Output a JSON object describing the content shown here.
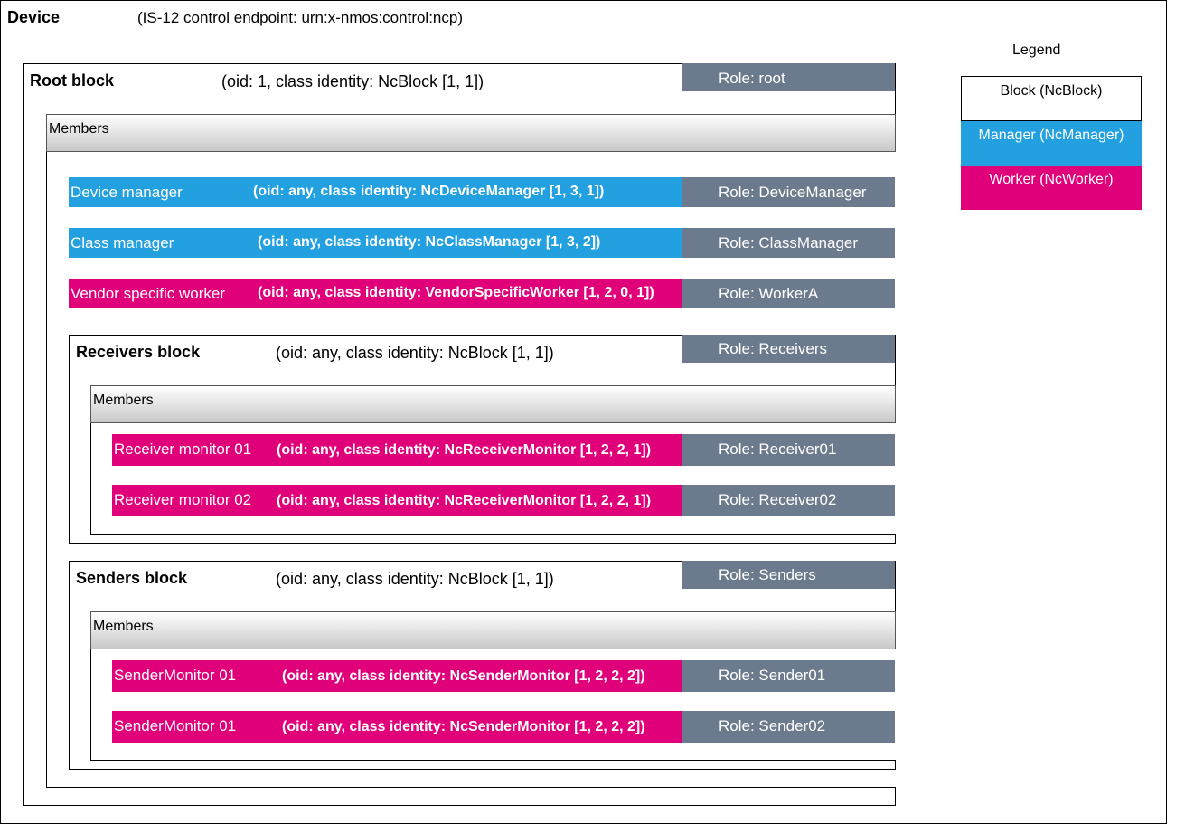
{
  "device": {
    "title": "Device",
    "subtitle": "(IS-12 control endpoint: urn:x-nmos:control:ncp)"
  },
  "legend": {
    "title": "Legend",
    "block": "Block (NcBlock)",
    "manager": "Manager (NcManager)",
    "worker": "Worker (NcWorker)"
  },
  "root": {
    "title": "Root block",
    "identity": "(oid: 1, class identity: NcBlock [1, 1])",
    "role": "Role: root",
    "members_label": "Members",
    "members": [
      {
        "name": "Device manager",
        "identity": "(oid: any, class identity: NcDeviceManager [1, 3, 1])",
        "role": "Role: DeviceManager",
        "kind": "manager"
      },
      {
        "name": "Class manager",
        "identity": "(oid: any, class identity: NcClassManager [1, 3, 2])",
        "role": "Role: ClassManager",
        "kind": "manager"
      },
      {
        "name": "Vendor specific worker",
        "identity": "(oid: any, class identity: VendorSpecificWorker [1, 2, 0, 1])",
        "role": "Role: WorkerA",
        "kind": "worker"
      }
    ]
  },
  "receivers": {
    "title": "Receivers block",
    "identity": "(oid: any, class identity: NcBlock [1, 1])",
    "role": "Role: Receivers",
    "members_label": "Members",
    "members": [
      {
        "name": "Receiver monitor 01",
        "identity": "(oid: any, class identity: NcReceiverMonitor [1, 2, 2, 1])",
        "role": "Role: Receiver01",
        "kind": "worker"
      },
      {
        "name": "Receiver monitor 02",
        "identity": "(oid: any, class identity: NcReceiverMonitor [1, 2, 2, 1])",
        "role": "Role: Receiver02",
        "kind": "worker"
      }
    ]
  },
  "senders": {
    "title": "Senders block",
    "identity": "(oid: any, class identity: NcBlock [1, 1])",
    "role": "Role: Senders",
    "members_label": "Members",
    "members": [
      {
        "name": "SenderMonitor 01",
        "identity": "(oid: any, class identity: NcSenderMonitor [1, 2, 2, 2])",
        "role": "Role: Sender01",
        "kind": "worker"
      },
      {
        "name": "SenderMonitor 01",
        "identity": "(oid: any, class identity: NcSenderMonitor [1, 2, 2, 2])",
        "role": "Role: Sender02",
        "kind": "worker"
      }
    ]
  },
  "colors": {
    "manager": "#22a0e0",
    "worker": "#e0007a",
    "role": "#6b7a8c",
    "members_bar_top": "#ffffff",
    "members_bar_bottom": "#c8c8c8"
  }
}
